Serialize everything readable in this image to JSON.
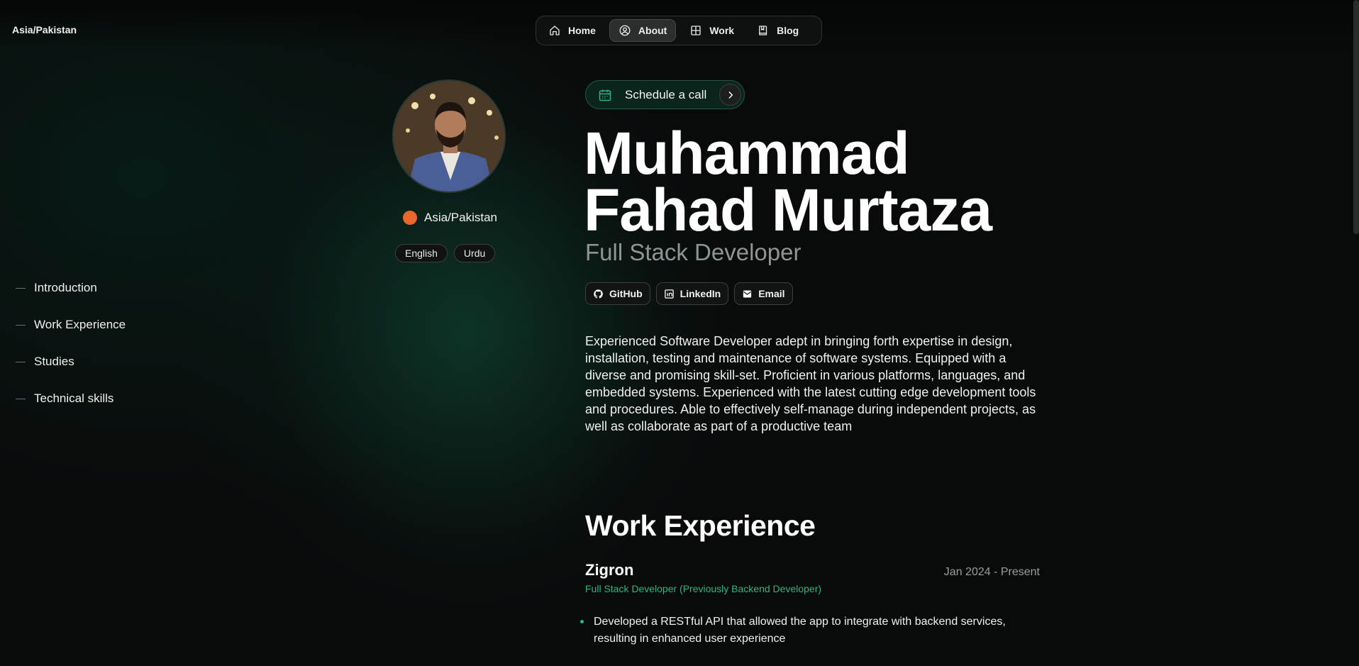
{
  "header": {
    "timezone": "Asia/Pakistan",
    "nav": [
      {
        "label": "Home",
        "icon": "home-icon"
      },
      {
        "label": "About",
        "icon": "user-circle-icon",
        "active": true
      },
      {
        "label": "Work",
        "icon": "grid-icon"
      },
      {
        "label": "Blog",
        "icon": "book-icon"
      }
    ]
  },
  "profile": {
    "location": "Asia/Pakistan",
    "languages": [
      "English",
      "Urdu"
    ]
  },
  "toc": [
    "Introduction",
    "Work Experience",
    "Studies",
    "Technical skills"
  ],
  "hero": {
    "schedule_label": "Schedule a call",
    "name_line1": "Muhammad",
    "name_line2": "Fahad Murtaza",
    "role": "Full Stack Developer",
    "socials": [
      {
        "label": "GitHub",
        "icon": "github-icon"
      },
      {
        "label": "LinkedIn",
        "icon": "linkedin-icon"
      },
      {
        "label": "Email",
        "icon": "email-icon"
      }
    ],
    "intro": "Experienced Software Developer adept in bringing forth expertise in design, installation, testing and maintenance of software systems. Equipped with a diverse and promising skill-set. Proficient in various platforms, languages, and embedded systems. Experienced with the latest cutting edge development tools and procedures. Able to effectively self-manage during independent projects, as well as collaborate as part of a productive team"
  },
  "experience": {
    "title": "Work Experience",
    "company": "Zigron",
    "dates": "Jan 2024 - Present",
    "position": "Full Stack Developer (Previously Backend Developer)",
    "bullets": [
      "Developed a RESTful API that allowed the app to integrate with backend services, resulting in enhanced user experience"
    ]
  },
  "colors": {
    "accent": "#2fb483",
    "background": "#090a0a"
  }
}
